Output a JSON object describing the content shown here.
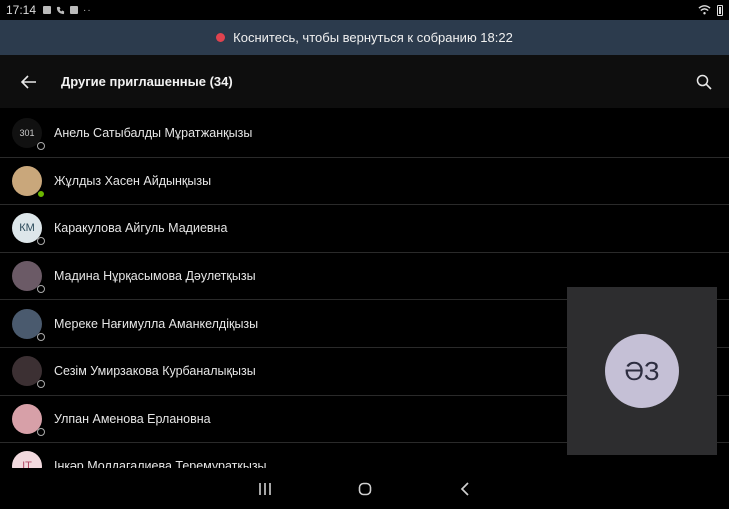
{
  "statusbar": {
    "time": "17:14",
    "more": "··"
  },
  "banner": {
    "text": "Коснитесь, чтобы вернуться к собранию 18:22"
  },
  "appbar": {
    "title": "Другие приглашенные (34)"
  },
  "contacts": [
    {
      "name": "Анель Сатыбалды Мұратжанқызы",
      "initials": "301",
      "status": "offline",
      "avatar_bg": "#111111"
    },
    {
      "name": "Жұлдыз Хасен Айдынқызы",
      "initials": "",
      "status": "available",
      "avatar_bg": "#c9a77b"
    },
    {
      "name": "Каракулова Айгуль Мадиевна",
      "initials": "КМ",
      "status": "offline",
      "avatar_bg": "#dde6ea"
    },
    {
      "name": "Мадина Нұрқасымова Дәулетқызы",
      "initials": "",
      "status": "offline",
      "avatar_bg": "#6b5a66"
    },
    {
      "name": "Мереке Нағимулла Аманкелдіқызы",
      "initials": "",
      "status": "offline",
      "avatar_bg": "#4a5a6e"
    },
    {
      "name": "Сезім Умирзакова Курбаналықызы",
      "initials": "",
      "status": "offline",
      "avatar_bg": "#3c3033"
    },
    {
      "name": "Улпан Аменова Ерлановна",
      "initials": "",
      "status": "offline",
      "avatar_bg": "#d7a0a8"
    },
    {
      "name": "Інкәр Молдагалиева Теремуратқызы",
      "initials": "ІТ",
      "status": "offline",
      "avatar_bg": "#f1d9de"
    }
  ],
  "video_tile": {
    "initials": "ӘЗ"
  },
  "colors": {
    "banner": "#2c3b4d",
    "record": "#e0434f",
    "available": "#6bb700"
  }
}
